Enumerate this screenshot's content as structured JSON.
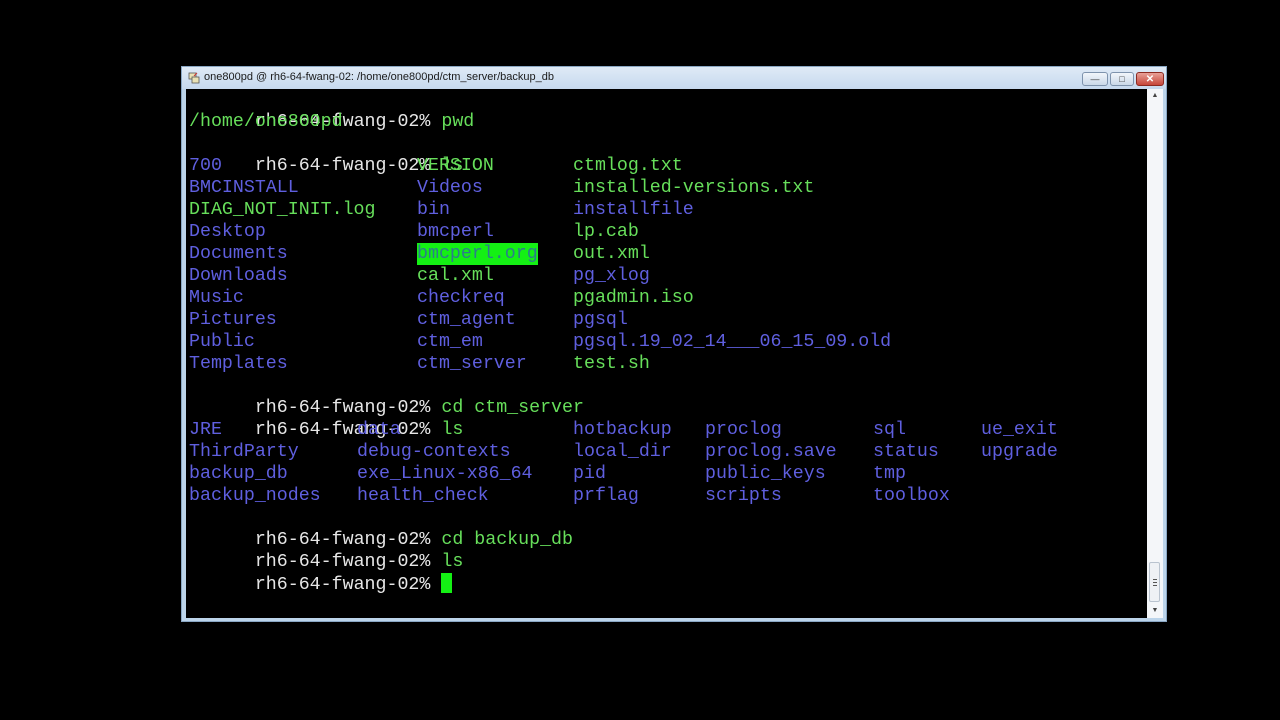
{
  "window": {
    "title": "one800pd @ rh6-64-fwang-02: /home/one800pd/ctm_server/backup_db",
    "buttons": {
      "minimize": "—",
      "maximize": "□",
      "close": "✕"
    }
  },
  "colors": {
    "prompt": "#e6e6e6",
    "command": "#67df5b",
    "directory": "#5f5fdf",
    "file": "#67df5b",
    "highlight_bg": "#14f014",
    "cursor": "#14f014"
  },
  "terminal": {
    "prompt": "rh6-64-fwang-02%",
    "cmd1": "pwd",
    "out1": "/home/one800pd",
    "cmd2": "ls",
    "listing1": [
      [
        "700",
        "VERSION",
        "ctmlog.txt"
      ],
      [
        "BMCINSTALL",
        "Videos",
        "installed-versions.txt"
      ],
      [
        "DIAG_NOT_INIT.log",
        "bin",
        "installfile"
      ],
      [
        "Desktop",
        "bmcperl",
        "lp.cab"
      ],
      [
        "Documents",
        "bmcperl.org",
        "out.xml"
      ],
      [
        "Downloads",
        "cal.xml",
        "pg_xlog"
      ],
      [
        "Music",
        "checkreq",
        "pgadmin.iso"
      ],
      [
        "Pictures",
        "ctm_agent",
        "pgsql"
      ],
      [
        "Public",
        "ctm_em",
        "pgsql.19_02_14___06_15_09.old"
      ],
      [
        "Templates",
        "ctm_server",
        "test.sh"
      ]
    ],
    "listing1_types": [
      [
        "dir",
        "file",
        "file"
      ],
      [
        "dir",
        "dir",
        "file"
      ],
      [
        "file",
        "dir",
        "dir"
      ],
      [
        "dir",
        "dir",
        "file"
      ],
      [
        "dir",
        "highlight",
        "file"
      ],
      [
        "dir",
        "file",
        "dir"
      ],
      [
        "dir",
        "dir",
        "file"
      ],
      [
        "dir",
        "dir",
        "dir"
      ],
      [
        "dir",
        "dir",
        "dir"
      ],
      [
        "dir",
        "dir",
        "file"
      ]
    ],
    "cmd3": "cd ctm_server",
    "cmd4": "ls",
    "listing2": [
      [
        "JRE",
        "data",
        "hotbackup",
        "proclog",
        "sql",
        "ue_exit"
      ],
      [
        "ThirdParty",
        "debug-contexts",
        "local_dir",
        "proclog.save",
        "status",
        "upgrade"
      ],
      [
        "backup_db",
        "exe_Linux-x86_64",
        "pid",
        "public_keys",
        "tmp",
        ""
      ],
      [
        "backup_nodes",
        "health_check",
        "prflag",
        "scripts",
        "toolbox",
        ""
      ]
    ],
    "cmd5": "cd backup_db",
    "cmd6": "ls"
  }
}
